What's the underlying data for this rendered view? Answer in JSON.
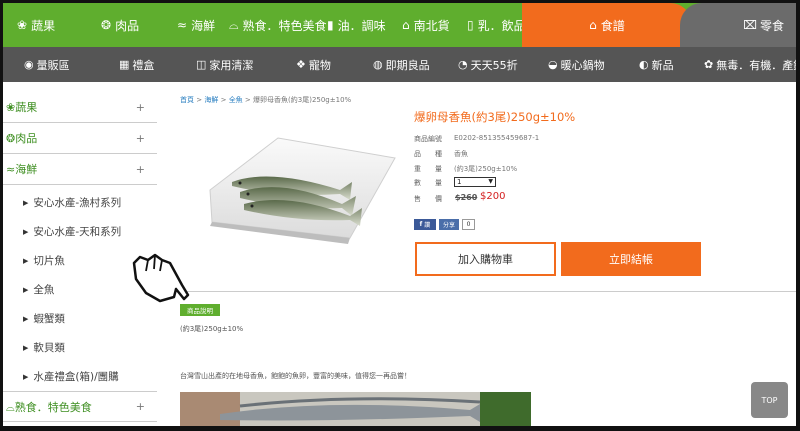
{
  "top_categories": [
    {
      "icon": "vegetable-icon",
      "glyph": "❀",
      "label": "蔬果"
    },
    {
      "icon": "meat-icon",
      "glyph": "❂",
      "label": "肉品"
    },
    {
      "icon": "fish-icon",
      "glyph": "≈",
      "label": "海鮮"
    },
    {
      "icon": "dish-icon",
      "glyph": "⌓",
      "label": "熟食．特色美食"
    },
    {
      "icon": "oil-icon",
      "glyph": "▮",
      "label": "油．調味"
    },
    {
      "icon": "house-icon",
      "glyph": "⌂",
      "label": "南北貨"
    },
    {
      "icon": "milk-icon",
      "glyph": "▯",
      "label": "乳．飲品"
    }
  ],
  "active_category": {
    "icon": "gift-icon",
    "glyph": "⌂",
    "label": "食譜"
  },
  "last_category": {
    "icon": "snack-icon",
    "glyph": "⌧",
    "label": "零食"
  },
  "sub_categories": [
    {
      "icon": "chat-icon",
      "glyph": "◉",
      "label": "量販區"
    },
    {
      "icon": "gift-box-icon",
      "glyph": "▦",
      "label": "禮盒"
    },
    {
      "icon": "cleaning-icon",
      "glyph": "◫",
      "label": "家用清潔"
    },
    {
      "icon": "pet-icon",
      "glyph": "❖",
      "label": "寵物"
    },
    {
      "icon": "tag-icon",
      "glyph": "◍",
      "label": "即期良品"
    },
    {
      "icon": "clock-icon",
      "glyph": "◔",
      "label": "天天55折"
    },
    {
      "icon": "hotpot-icon",
      "glyph": "◒",
      "label": "暖心鍋物"
    },
    {
      "icon": "new-icon",
      "glyph": "◐",
      "label": "新品"
    },
    {
      "icon": "leaf-icon",
      "glyph": "✿",
      "label": "無毒．有機．產銷"
    }
  ],
  "sidebar": {
    "categories_top": [
      {
        "icon": "vegetable-icon",
        "glyph": "❀",
        "label": "蔬果",
        "toggle": "+"
      },
      {
        "icon": "meat-icon",
        "glyph": "❂",
        "label": "肉品",
        "toggle": "+"
      },
      {
        "icon": "fish-icon",
        "glyph": "≈",
        "label": "海鮮",
        "toggle": "+"
      }
    ],
    "seafood_items": [
      "安心水產-漁村系列",
      "安心水產-天和系列",
      "切片魚",
      "全魚",
      "蝦蟹類",
      "軟貝類",
      "水產禮盒(箱)/團購"
    ],
    "category_bottom": {
      "icon": "dish-icon",
      "glyph": "⌓",
      "label": "熟食．特色美食",
      "toggle": "+"
    }
  },
  "breadcrumb": {
    "home": "首頁",
    "sep": ">",
    "level1": "海鮮",
    "level2": "全魚",
    "current": "爆卵母香魚(約3尾)250g±10%"
  },
  "product": {
    "name": "爆卵母香魚(約3尾)250g±10%",
    "code_label": "商品編號",
    "code": "E0202-851355459687-1",
    "name_label": "品　　種",
    "variety": "香魚",
    "weight_label": "重　　量",
    "weight": "(約3尾)250g±10%",
    "qty_label": "數　　量",
    "qty_value": "1",
    "price_label": "售　　價",
    "price_old": "$260",
    "price_new": "$200"
  },
  "share": {
    "fb_label": "讚",
    "share_label": "分享",
    "count": "0"
  },
  "buttons": {
    "add_to_cart": "加入購物車",
    "checkout": "立即結帳",
    "top": "TOP"
  },
  "description": {
    "badge": "商品說明",
    "spec": "(約3尾)250g±10%",
    "text": "台灣雪山出產的在地母香魚，飽飽的魚卵，豐富的美味，值得您一再品嘗！"
  },
  "colors": {
    "green": "#5fae2e",
    "orange": "#f26b1d",
    "dark_gray": "#555555",
    "price_red": "#d42020"
  }
}
